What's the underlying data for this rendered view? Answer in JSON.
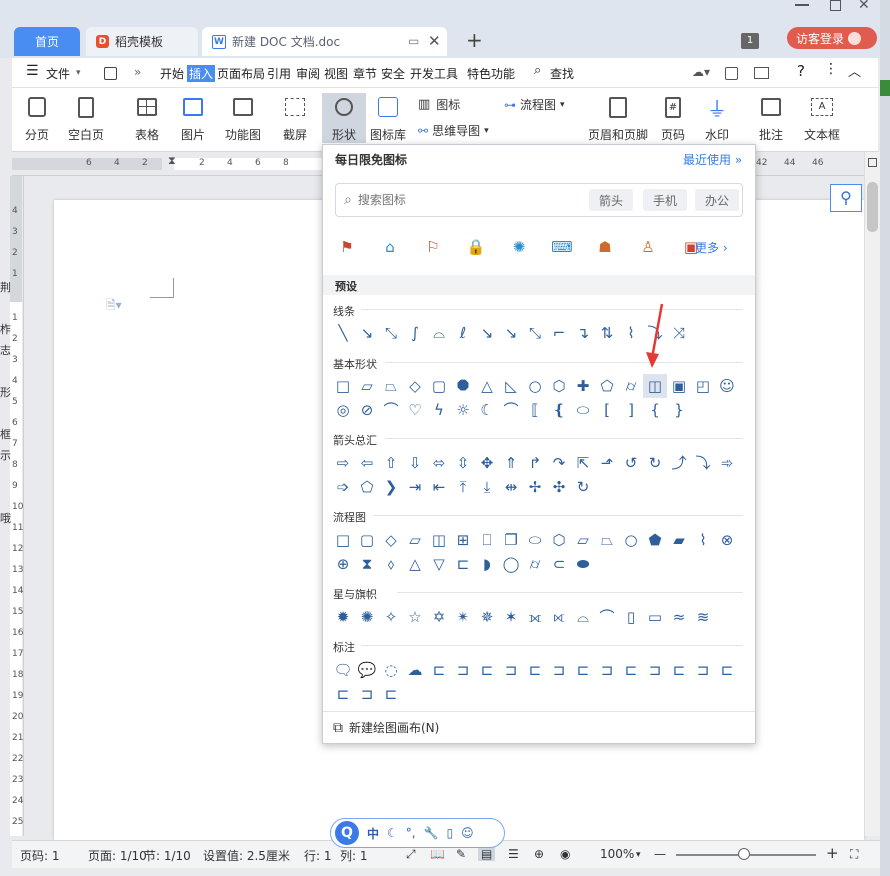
{
  "tabs": {
    "home": "首页",
    "template": "稻壳模板",
    "doc": "新建 DOC 文档.doc",
    "add": "+",
    "badge": "1",
    "login": "访客登录"
  },
  "menu": {
    "file": "文件",
    "more": "»",
    "items": [
      "开始",
      "插入",
      "页面布局",
      "引用",
      "审阅",
      "视图",
      "章节",
      "安全",
      "开发工具",
      "特色功能"
    ],
    "search": "查找",
    "help": "?"
  },
  "ribbon": {
    "page_break": "分页",
    "blank_page": "空白页",
    "table": "表格",
    "picture": "图片",
    "function_chart": "功能图",
    "screenshot": "截屏",
    "shape": "形状",
    "icon_lib": "图标库",
    "icon": "图标",
    "mindmap": "思维导图",
    "flowchart": "流程图",
    "header_footer": "页眉和页脚",
    "page_num": "页码",
    "watermark": "水印",
    "comment": "批注",
    "textbox": "文本框"
  },
  "ruler": {
    "h": [
      "6",
      "4",
      "2",
      "2",
      "4",
      "6",
      "8"
    ],
    "h_right": [
      "42",
      "44",
      "46"
    ],
    "v": [
      "4",
      "3",
      "2",
      "1",
      "1",
      "2",
      "3",
      "4",
      "5",
      "6",
      "7",
      "8",
      "9",
      "10",
      "11",
      "12",
      "13",
      "14",
      "15",
      "16",
      "17",
      "18",
      "19",
      "20",
      "21",
      "22",
      "23",
      "24",
      "25",
      "26"
    ]
  },
  "left_chars": [
    "荆",
    "柞",
    "志",
    "形",
    "框",
    "示",
    "哦"
  ],
  "panel": {
    "title": "每日限免图标",
    "recent": "最近使用",
    "search_placeholder": "搜索图标",
    "chips": [
      "箭头",
      "手机",
      "办公"
    ],
    "more": "更多",
    "preset": "预设",
    "sections": {
      "lines": "线条",
      "basic": "基本形状",
      "arrows": "箭头总汇",
      "flow": "流程图",
      "stars": "星与旗帜",
      "callout": "标注"
    },
    "new_canvas": "新建绘图画布(N)"
  },
  "status": {
    "page_code": "页码: 1",
    "page": "页面: 1/10",
    "section": "节: 1/10",
    "setting": "设置值: 2.5厘米",
    "row": "行: 1",
    "col": "列: 1",
    "zoom": "100%",
    "minus": "—",
    "plus": "+"
  },
  "ime": {
    "lang": "中"
  },
  "colors": {
    "accent": "#4a8df2",
    "arrow": "#e53935",
    "shape_blue": "#2f5f9a"
  }
}
